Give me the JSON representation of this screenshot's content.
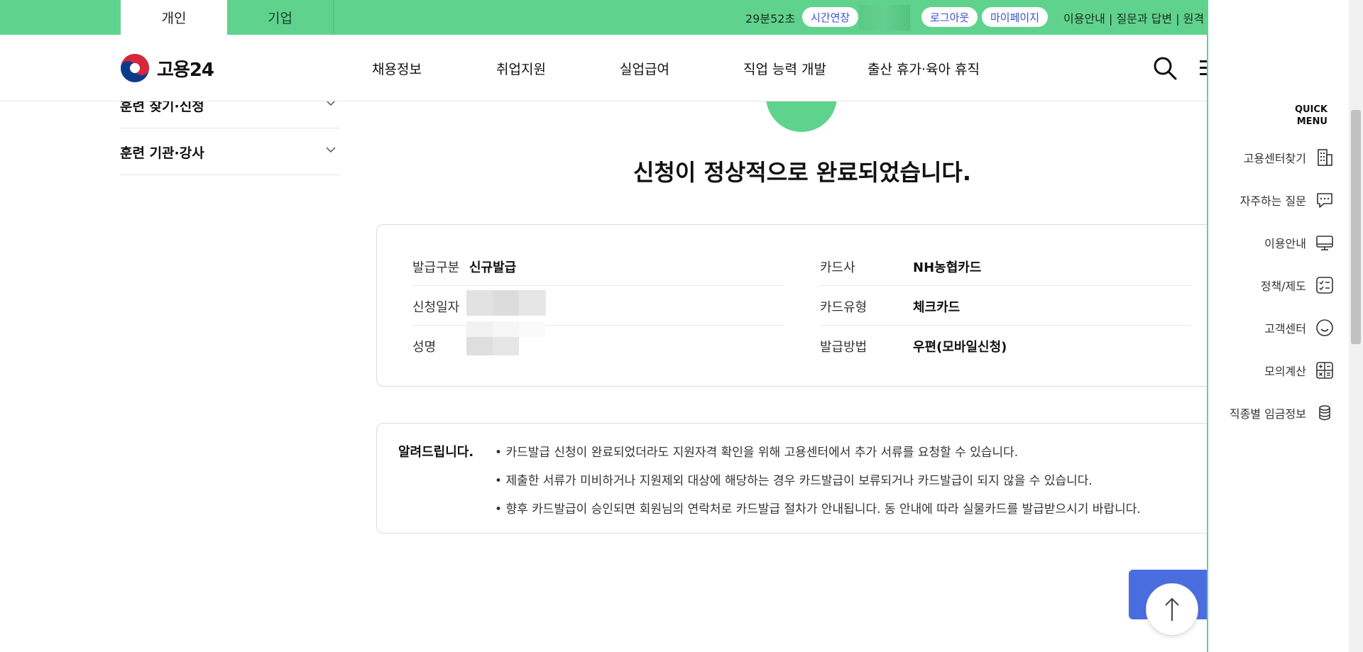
{
  "topbar": {
    "tabs": [
      {
        "label": "개인"
      },
      {
        "label": "기업"
      }
    ],
    "timer": "29분52초",
    "extend_label": "시간연장",
    "logout_label": "로그아웃",
    "mypage_label": "마이페이지",
    "util_text": "이용안내 | 질문과 답변 | 원격"
  },
  "header": {
    "logo_text": "고용24",
    "nav": [
      "채용정보",
      "취업지원",
      "실업급여",
      "직업 능력 개발",
      "출산 휴가·육아 휴직"
    ]
  },
  "sidebar": {
    "items": [
      {
        "label": "훈련 찾기·신청"
      },
      {
        "label": "훈련 기관·강사"
      }
    ]
  },
  "main": {
    "title": "신청이 정상적으로 완료되었습니다.",
    "left_rows": [
      {
        "label": "발급구분",
        "value": "신규발급"
      },
      {
        "label": "신청일자",
        "value": ""
      },
      {
        "label": "성명",
        "value": ""
      }
    ],
    "right_rows": [
      {
        "label": "카드사",
        "value": "NH농협카드"
      },
      {
        "label": "카드유형",
        "value": "체크카드"
      },
      {
        "label": "발급방법",
        "value": "우편(모바일신청)"
      }
    ],
    "notice": {
      "title": "알려드립니다.",
      "items": [
        "카드발급 신청이 완료되었더라도 지원자격 확인을 위해 고용센터에서 추가 서류를 요청할 수 있습니다.",
        "제출한 서류가 미비하거나 지원제외 대상에 해당하는 경우 카드발급이 보류되거나 카드발급이 되지 않을 수 있습니다.",
        "향후 카드발급이 승인되면 회원님의 연락처로 카드발급 절차가 안내됩니다. 동 안내에 따라 실물카드를 발급받으시기 바랍니다."
      ]
    }
  },
  "quick_menu": {
    "title_line1": "QUICK",
    "title_line2": "MENU",
    "items": [
      {
        "label": "고용센터찾기",
        "icon": "building-icon"
      },
      {
        "label": "자주하는 질문",
        "icon": "chat-icon"
      },
      {
        "label": "이용안내",
        "icon": "monitor-icon"
      },
      {
        "label": "정책/제도",
        "icon": "checklist-icon"
      },
      {
        "label": "고객센터",
        "icon": "smile-icon"
      },
      {
        "label": "모의계산",
        "icon": "calculator-icon"
      },
      {
        "label": "직종별 임금정보",
        "icon": "coins-icon"
      }
    ]
  },
  "colors": {
    "brand_green": "#5fd38d",
    "link_blue": "#3553d0",
    "button_blue": "#4a6ee0"
  }
}
